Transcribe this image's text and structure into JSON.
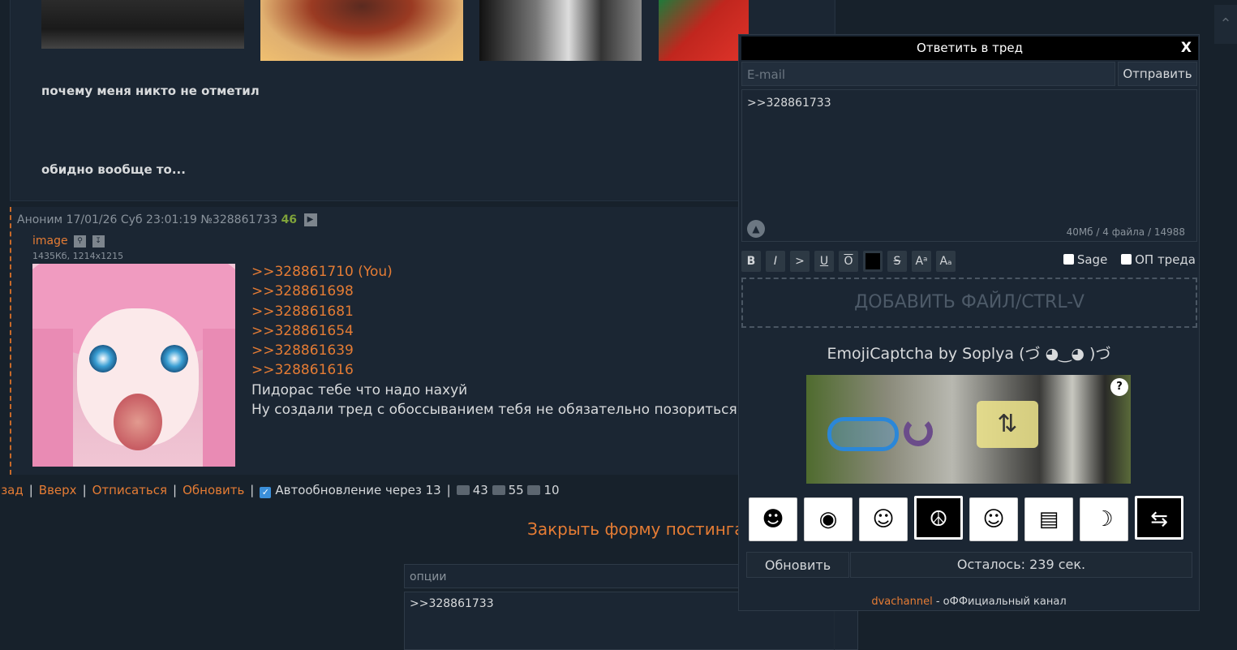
{
  "op_post": {
    "text_line1": "почему меня никто не отметил",
    "text_line2": "обидно вообще то..."
  },
  "reply_post": {
    "author": "Аноним",
    "datetime": "17/01/26 Суб 23:01:19",
    "number": "№328861733",
    "reply_count": "46",
    "file_name": "image",
    "file_meta": "1435Кб, 1214x1215",
    "refs": [
      ">>328861710 (You)",
      ">>328861698",
      ">>328861681",
      ">>328861654",
      ">>328861639",
      ">>328861616"
    ],
    "lines": [
      "Пидорас тебе что надо нахуй",
      "Ну создали тред с обоссыванием тебя не обязательно позориться да"
    ]
  },
  "thread_nav": {
    "back": "азад",
    "up": "Вверх",
    "unsubscribe": "Отписаться",
    "refresh": "Обновить",
    "autorefresh": "Автообновление через 13",
    "posts": "43",
    "images": "55",
    "posters": "10"
  },
  "close_form": "Закрыть форму постинга",
  "bottom_form": {
    "options_placeholder": "опции",
    "text": ">>328861733"
  },
  "quick_reply": {
    "title": "Ответить в тред",
    "close": "X",
    "email_placeholder": "E-mail",
    "send": "Отправить",
    "text": ">>328861733",
    "limits": "40Мб / 4 файла / 14988",
    "toolbar": [
      "B",
      "I",
      ">",
      "U",
      "O",
      "",
      "S",
      "Aᵃ",
      "Aₐ"
    ],
    "sage": "Sage",
    "op_thread": "ОП треда",
    "drop": "ДОБАВИТЬ ФАЙЛ/CTRL-V",
    "captcha_title": "EmojiCaptcha by Soplya (づ ◕‿◕ )づ",
    "captcha_help": "?",
    "emojis": [
      "face-icon",
      "diving-mask-icon",
      "construction-worker-icon",
      "peace-symbol-icon",
      "santa-icon",
      "tram-icon",
      "banana-icon",
      "repeat-icon"
    ],
    "captcha_refresh": "Обновить",
    "captcha_left": "Осталось: 239 сек.",
    "footer_link": "dvachannel",
    "footer_text": " - оФФициальный канал"
  }
}
